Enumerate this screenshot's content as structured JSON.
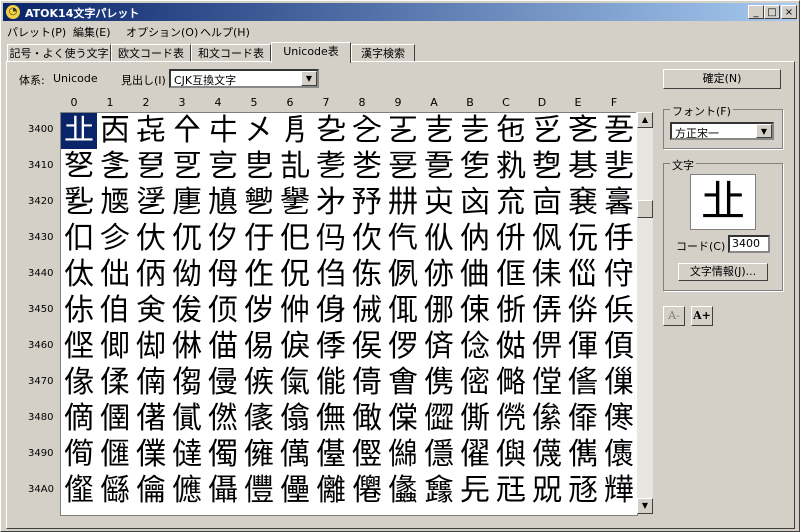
{
  "window": {
    "title": "ATOK14文字パレット",
    "controls": {
      "minimize": "_",
      "maximize": "□",
      "close": "×"
    }
  },
  "menu": [
    "パレット(P)",
    "編集(E)",
    "オプション(O)",
    "ヘルプ(H)"
  ],
  "tabs": [
    "記号・よく使う文字",
    "欧文コード表",
    "和文コード表",
    "Unicode表",
    "漢字検索"
  ],
  "active_tab": "Unicode表",
  "toolbar": {
    "system_label": "体系:",
    "system_value": "Unicode",
    "heading_label": "見出し(I)",
    "heading_value": "CJK互換文字"
  },
  "grid": {
    "columns": [
      "0",
      "1",
      "2",
      "3",
      "4",
      "5",
      "6",
      "7",
      "8",
      "9",
      "A",
      "B",
      "C",
      "D",
      "E",
      "F"
    ],
    "rows": [
      {
        "code": "3400",
        "chars": [
          "㐀",
          "㐁",
          "㐂",
          "㐃",
          "㐄",
          "㐅",
          "㐆",
          "㐇",
          "㐈",
          "㐉",
          "㐊",
          "㐋",
          "㐌",
          "㐍",
          "㐎",
          "㐏"
        ]
      },
      {
        "code": "3410",
        "chars": [
          "㐐",
          "㐑",
          "㐒",
          "㐓",
          "㐔",
          "㐕",
          "㐖",
          "㐗",
          "㐘",
          "㐙",
          "㐚",
          "㐛",
          "㐜",
          "㐝",
          "㐞",
          "㐟"
        ]
      },
      {
        "code": "3420",
        "chars": [
          "㐠",
          "㐡",
          "㐢",
          "㐣",
          "㐤",
          "㐥",
          "㐦",
          "㐧",
          "㐨",
          "㐩",
          "㐪",
          "㐫",
          "㐬",
          "㐭",
          "㐮",
          "㐯"
        ]
      },
      {
        "code": "3430",
        "chars": [
          "㐰",
          "㐱",
          "㐲",
          "㐳",
          "㐴",
          "㐵",
          "㐶",
          "㐷",
          "㐸",
          "㐹",
          "㐺",
          "㐻",
          "㐼",
          "㐽",
          "㐾",
          "㐿"
        ]
      },
      {
        "code": "3440",
        "chars": [
          "㑀",
          "㑁",
          "㑂",
          "㑃",
          "㑄",
          "㑅",
          "㑆",
          "㑇",
          "㑈",
          "㑉",
          "㑊",
          "㑋",
          "㑌",
          "㑍",
          "㑎",
          "㑏"
        ]
      },
      {
        "code": "3450",
        "chars": [
          "㑐",
          "㑑",
          "㑒",
          "㑓",
          "㑔",
          "㑕",
          "㑖",
          "㑗",
          "㑘",
          "㑙",
          "㑚",
          "㑛",
          "㑜",
          "㑝",
          "㑞",
          "㑟"
        ]
      },
      {
        "code": "3460",
        "chars": [
          "㑠",
          "㑡",
          "㑢",
          "㑣",
          "㑤",
          "㑥",
          "㑦",
          "㑧",
          "㑨",
          "㑩",
          "㑪",
          "㑫",
          "㑬",
          "㑭",
          "㑮",
          "㑯"
        ]
      },
      {
        "code": "3470",
        "chars": [
          "㑰",
          "㑱",
          "㑲",
          "㑳",
          "㑴",
          "㑵",
          "㑶",
          "㑷",
          "㑸",
          "㑹",
          "㑺",
          "㑻",
          "㑼",
          "㑽",
          "㑾",
          "㑿"
        ]
      },
      {
        "code": "3480",
        "chars": [
          "㒀",
          "㒁",
          "㒂",
          "㒃",
          "㒄",
          "㒅",
          "㒆",
          "㒇",
          "㒈",
          "㒉",
          "㒊",
          "㒋",
          "㒌",
          "㒍",
          "㒎",
          "㒏"
        ]
      },
      {
        "code": "3490",
        "chars": [
          "㒐",
          "㒑",
          "㒒",
          "㒓",
          "㒔",
          "㒕",
          "㒖",
          "㒗",
          "㒘",
          "㒙",
          "㒚",
          "㒛",
          "㒜",
          "㒝",
          "㒞",
          "㒟"
        ]
      },
      {
        "code": "34A0",
        "chars": [
          "㒠",
          "㒡",
          "㒢",
          "㒣",
          "㒤",
          "㒥",
          "㒦",
          "㒧",
          "㒨",
          "㒩",
          "㒪",
          "㒫",
          "㒬",
          "㒭",
          "㒮",
          "㒯"
        ]
      }
    ]
  },
  "right": {
    "confirm_button": "確定(N)",
    "font_group": "フォント(F)",
    "font_value": "方正宋一",
    "char_group": "文字",
    "selected_char": "㐀",
    "code_label": "コード(C)",
    "code_value": "3400",
    "info_button": "文字情報(J)...",
    "shrink_label": "A-",
    "enlarge_label": "A+"
  },
  "colors": {
    "title_start": "#0a246a",
    "title_end": "#a6caf0",
    "selection": "#0a246a"
  }
}
